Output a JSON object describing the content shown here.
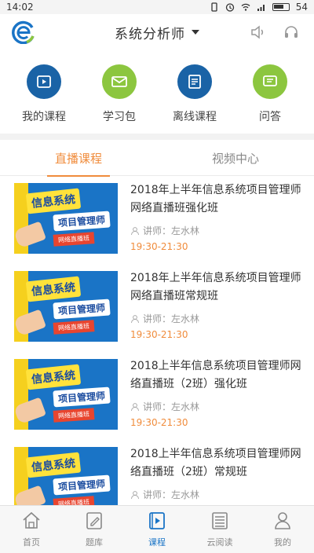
{
  "status_bar": {
    "time": "14:02",
    "battery": "54"
  },
  "header": {
    "title": "系统分析师"
  },
  "features": [
    {
      "label": "我的课程",
      "icon": "play-video-icon",
      "color": "#1a63a6"
    },
    {
      "label": "学习包",
      "icon": "envelope-icon",
      "color": "#8cc63f"
    },
    {
      "label": "离线课程",
      "icon": "download-file-icon",
      "color": "#1a63a6"
    },
    {
      "label": "问答",
      "icon": "chat-icon",
      "color": "#8cc63f"
    }
  ],
  "tabs": [
    {
      "label": "直播课程",
      "active": true
    },
    {
      "label": "视频中心",
      "active": false
    }
  ],
  "thumbnail": {
    "line1": "信息系统",
    "line2": "项目管理师",
    "line3": "网络直播班"
  },
  "courses": [
    {
      "title": "2018年上半年信息系统项目管理师网络直播班强化班",
      "teacher": "讲师：左水林",
      "time": "19:30-21:30"
    },
    {
      "title": "2018年上半年信息系统项目管理师网络直播班常规班",
      "teacher": "讲师：左水林",
      "time": "19:30-21:30"
    },
    {
      "title": "2018上半年信息系统项目管理师网络直播班（2班）强化班",
      "teacher": "讲师：左水林",
      "time": "19:30-21:30"
    },
    {
      "title": "2018上半年信息系统项目管理师网络直播班（2班）常规班",
      "teacher": "讲师：左水林",
      "time": ""
    }
  ],
  "bottom_nav": [
    {
      "label": "首页",
      "icon": "home-icon"
    },
    {
      "label": "题库",
      "icon": "edit-icon"
    },
    {
      "label": "课程",
      "icon": "course-icon",
      "active": true
    },
    {
      "label": "云阅读",
      "icon": "reader-icon"
    },
    {
      "label": "我的",
      "icon": "user-icon"
    }
  ],
  "colors": {
    "accent": "#f08c3c",
    "brand_blue": "#1a74c6",
    "green": "#8cc63f"
  }
}
